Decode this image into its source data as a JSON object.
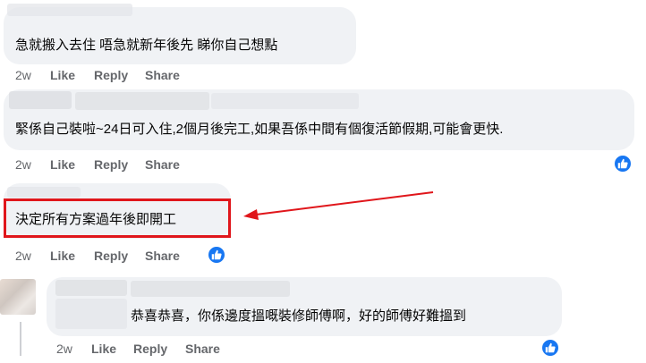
{
  "comments": [
    {
      "text": "急就搬入去住 唔急就新年後先 睇你自己想點",
      "time": "2w",
      "like": "Like",
      "reply": "Reply",
      "share": "Share",
      "reacted": false
    },
    {
      "text": "緊係自己裝啦~24日可入住,2個月後完工,如果吾係中間有個復活節假期,可能會更快.",
      "time": "2w",
      "like": "Like",
      "reply": "Reply",
      "share": "Share",
      "reacted": true
    },
    {
      "text": "決定所有方案過年後即開工",
      "time": "2w",
      "like": "Like",
      "reply": "Reply",
      "share": "Share",
      "reacted": true
    },
    {
      "text": "恭喜恭喜，你係邊度搵嘅裝修師傅啊，好的師傅好難搵到",
      "time": "2w",
      "like": "Like",
      "reply": "Reply",
      "share": "Share",
      "reacted": true
    }
  ],
  "annotation": {
    "color": "#e0161b"
  },
  "colors": {
    "bubble": "#f0f2f5",
    "meta": "#65676b",
    "like_blue": "#1877f2"
  },
  "icons": [
    "thumbs-up-reaction-icon"
  ]
}
